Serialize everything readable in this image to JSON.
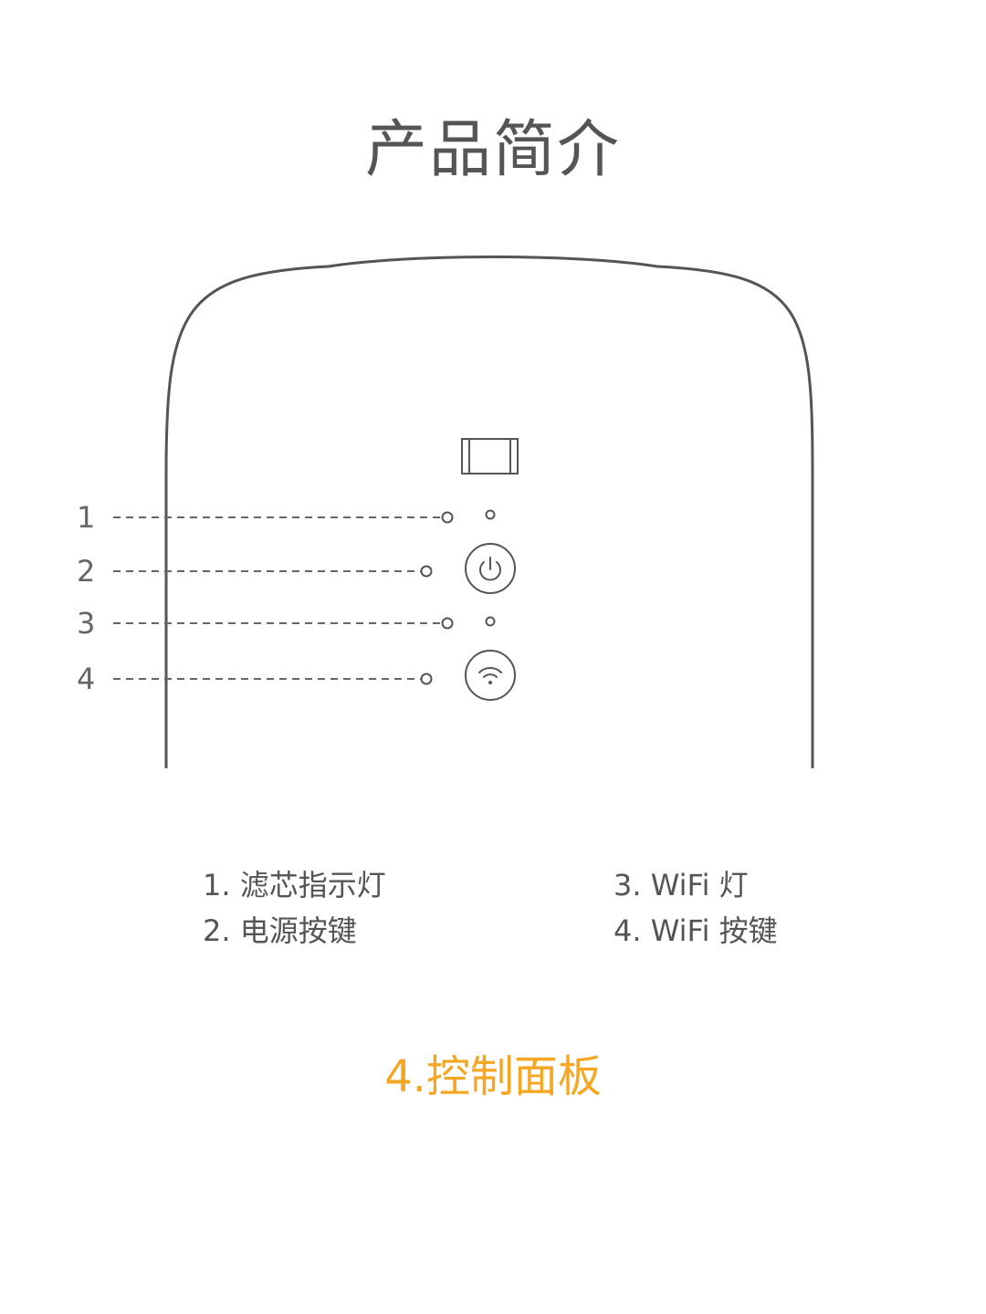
{
  "title": "产品简介",
  "callouts": [
    "1",
    "2",
    "3",
    "4"
  ],
  "legend": {
    "item1": "1. 滤芯指示灯",
    "item2": "2. 电源按键",
    "item3": "3. WiFi 灯",
    "item4": "4. WiFi 按键"
  },
  "caption": "4.控制面板",
  "colors": {
    "outline": "#555555",
    "text": "#555555",
    "accent": "#f5a623"
  },
  "icons": [
    "filter-indicator-icon",
    "power-icon",
    "wifi-icon"
  ]
}
